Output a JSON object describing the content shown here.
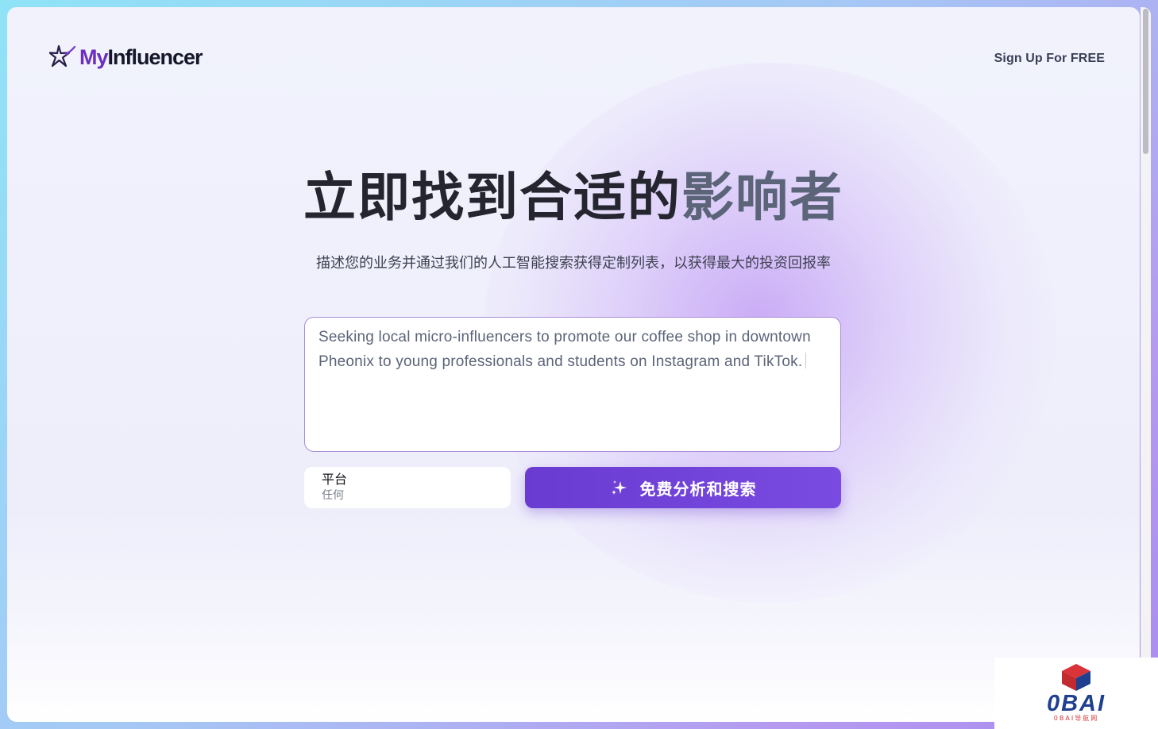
{
  "brand": {
    "name_part1": "My",
    "name_part2": "Influencer"
  },
  "header": {
    "signup_label": "Sign Up For FREE"
  },
  "hero": {
    "title_dark": "立即找到合适的",
    "title_light": "影响者",
    "subtitle": "描述您的业务并通过我们的人工智能搜索获得定制列表，以获得最大的投资回报率"
  },
  "search": {
    "description_value": "Seeking local micro-influencers to promote our coffee shop in downtown Pheonix to young professionals and students on Instagram and TikTok.",
    "platform_label": "平台",
    "platform_value": "任何",
    "submit_label": "免费分析和搜索"
  },
  "watermark": {
    "title": "0BAI",
    "subtitle": "0BAI导航网"
  },
  "colors": {
    "accent": "#6a3bd1",
    "brand_purple": "#6b2fbf",
    "text_dark": "#24252e"
  }
}
